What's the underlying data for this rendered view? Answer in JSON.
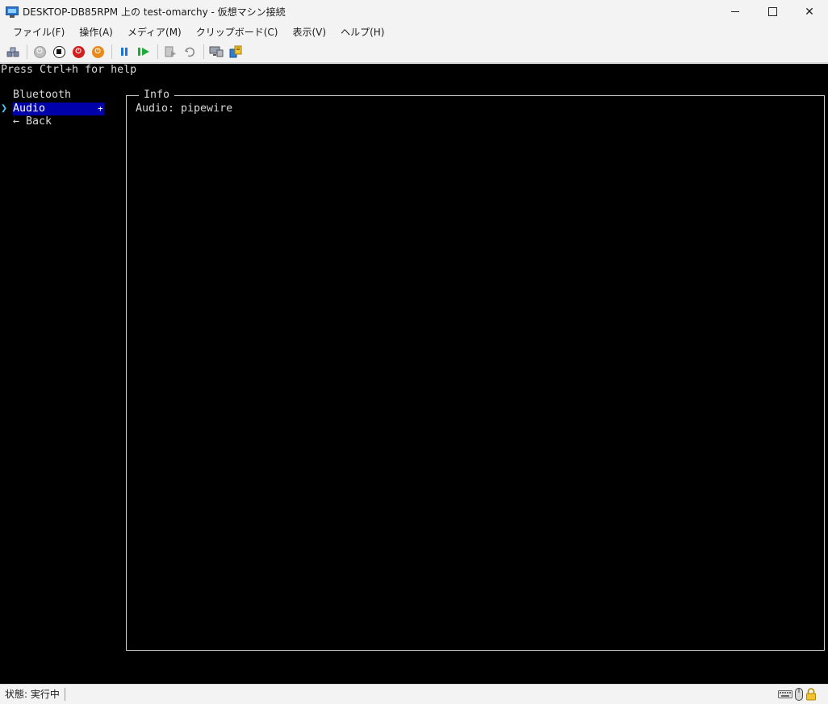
{
  "window": {
    "title": "DESKTOP-DB85RPM 上の test-omarchy  - 仮想マシン接続"
  },
  "menu": {
    "items": [
      "ファイル(F)",
      "操作(A)",
      "メディア(M)",
      "クリップボード(C)",
      "表示(V)",
      "ヘルプ(H)"
    ]
  },
  "toolbar": {
    "icons": [
      "ctrl-alt-del-icon",
      "start-icon",
      "turn-off-icon",
      "shutdown-icon",
      "save-icon",
      "pause-icon",
      "resume-icon",
      "checkpoint-icon",
      "revert-icon",
      "enhanced-session-icon",
      "share-icon"
    ]
  },
  "console": {
    "help": "Press Ctrl+h for help",
    "nav": {
      "items": [
        "Bluetooth",
        "Audio",
        "← Back"
      ],
      "selected_index": 1,
      "cursor": "❯",
      "selected_marker": "+"
    },
    "info": {
      "title": "Info",
      "text": "Audio: pipewire"
    },
    "colors": {
      "background": "#000000",
      "selection": "#0000aa",
      "cursor": "#3ad0ff"
    }
  },
  "status": {
    "text": "状態: 実行中",
    "icons": [
      "keyboard-icon",
      "mouse-icon",
      "lock-icon"
    ]
  }
}
